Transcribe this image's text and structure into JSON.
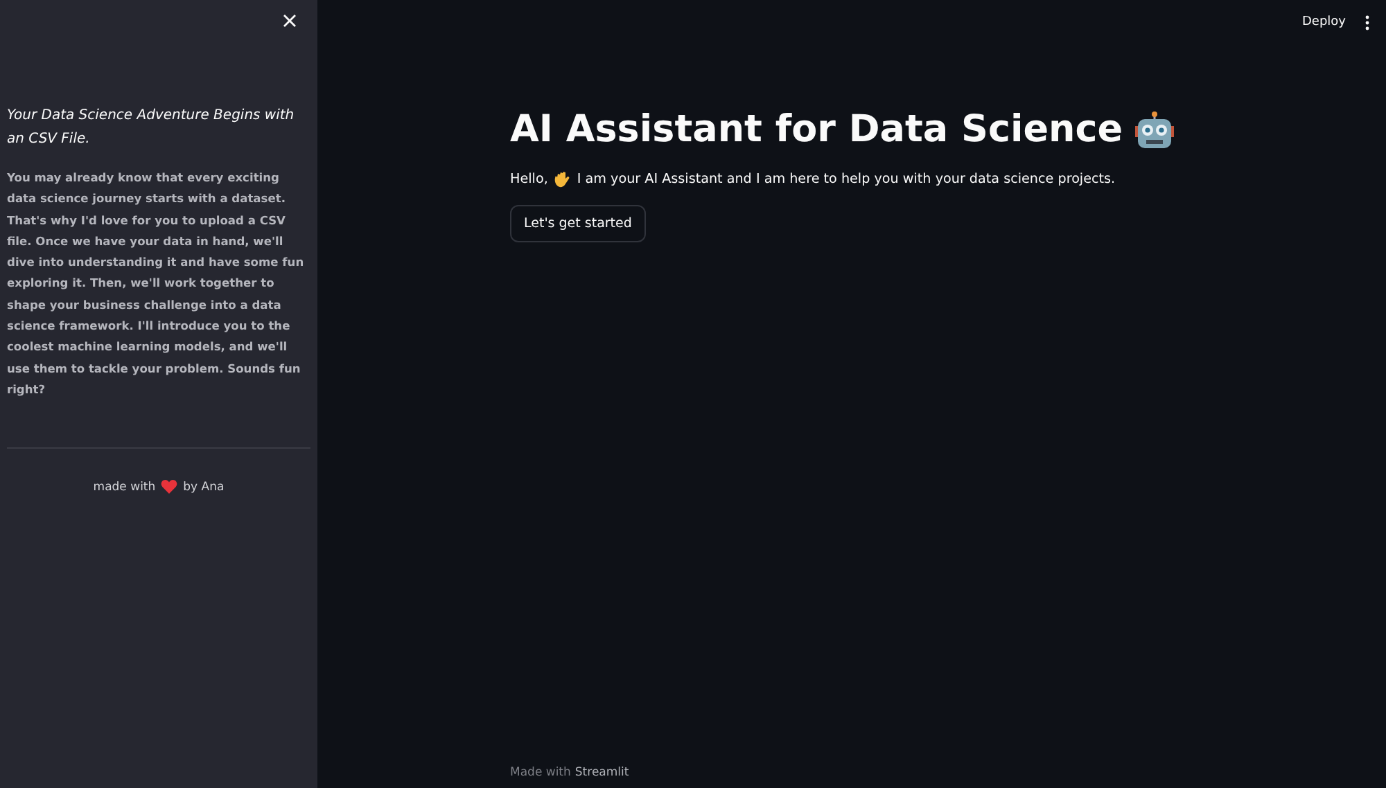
{
  "sidebar": {
    "heading": "Your Data Science Adventure Begins with an CSV File.",
    "paragraph": "You may already know that every exciting data science journey starts with a dataset. That's why I'd love for you to upload a CSV file. Once we have your data in hand, we'll dive into understanding it and have some fun exploring it. Then, we'll work together to shape your business challenge into a data science framework. I'll introduce you to the coolest machine learning models, and we'll use them to tackle your problem. Sounds fun right?",
    "credit_before": "made with",
    "credit_after": "by Ana"
  },
  "header": {
    "deploy": "Deploy"
  },
  "main": {
    "title": "AI Assistant for Data Science",
    "greeting_before": "Hello,",
    "greeting_after": "I am your AI Assistant and I am here to help you with your data science projects.",
    "button": "Let's get started"
  },
  "footer": {
    "prefix": "Made with",
    "brand": "Streamlit"
  }
}
